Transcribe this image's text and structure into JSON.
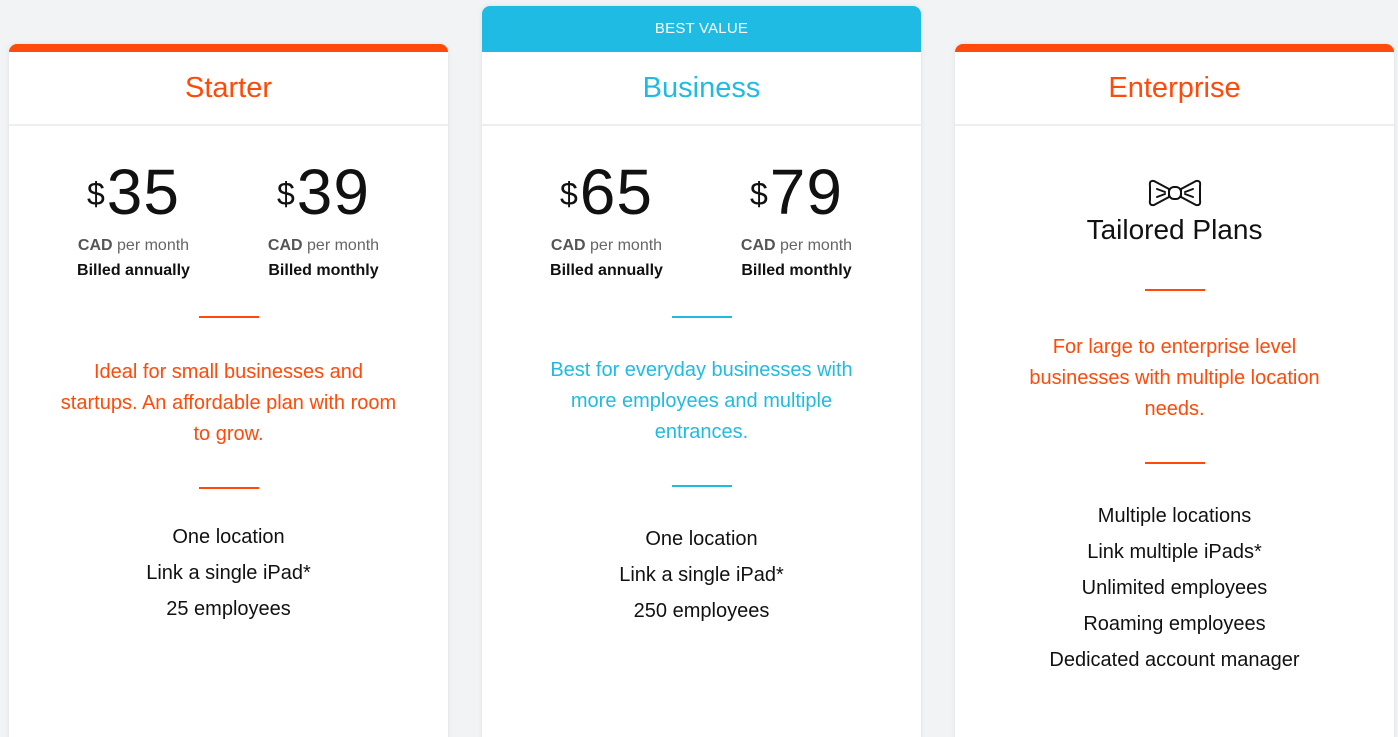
{
  "colors": {
    "accent_orange": "#ff4a0a",
    "accent_blue": "#1fbbe3"
  },
  "starter": {
    "title": "Starter",
    "annual": {
      "currency_symbol": "$",
      "amount": "35",
      "cad": "CAD",
      "per": "per month",
      "billed": "Billed annually"
    },
    "monthly": {
      "currency_symbol": "$",
      "amount": "39",
      "cad": "CAD",
      "per": "per month",
      "billed": "Billed monthly"
    },
    "description": "Ideal for small businesses and startups. An affordable plan with room to grow.",
    "features": [
      "One location",
      "Link a single iPad*",
      "25 employees"
    ]
  },
  "business": {
    "badge": "BEST VALUE",
    "title": "Business",
    "annual": {
      "currency_symbol": "$",
      "amount": "65",
      "cad": "CAD",
      "per": "per month",
      "billed": "Billed annually"
    },
    "monthly": {
      "currency_symbol": "$",
      "amount": "79",
      "cad": "CAD",
      "per": "per month",
      "billed": "Billed monthly"
    },
    "description": "Best for everyday businesses with more employees and multiple entrances.",
    "features": [
      "One location",
      "Link a single iPad*",
      "250 employees"
    ]
  },
  "enterprise": {
    "title": "Enterprise",
    "icon": "bowtie-icon",
    "tailored": "Tailored Plans",
    "description": "For large to enterprise level businesses with multiple location needs.",
    "features": [
      "Multiple locations",
      "Link multiple iPads*",
      "Unlimited employees",
      "Roaming employees",
      "Dedicated account manager"
    ]
  }
}
